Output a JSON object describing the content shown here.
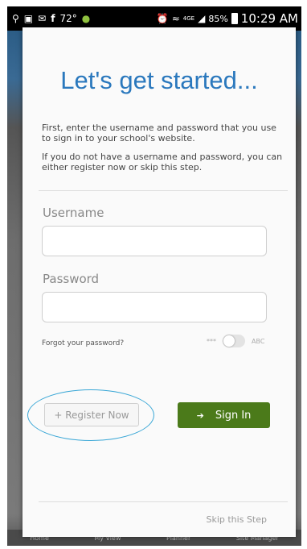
{
  "status_bar": {
    "temperature": "72°",
    "network": "4GE",
    "battery_percent": "85%",
    "time": "10:29 AM"
  },
  "modal": {
    "title": "Let's get started...",
    "intro_1": "First, enter the username and password that you use to sign in to your school's website.",
    "intro_2": "If you do not have a username and password, you can either register now or skip this step.",
    "username_label": "Username",
    "password_label": "Password",
    "forgot_password": "Forgot your password?",
    "toggle_off_label": "***",
    "toggle_on_label": "ABC",
    "register_button": "+ Register Now",
    "signin_button": "Sign In",
    "skip_link": "Skip this Step"
  },
  "background_tabs": [
    "Home",
    "My View",
    "Planner",
    "Site Manager"
  ]
}
